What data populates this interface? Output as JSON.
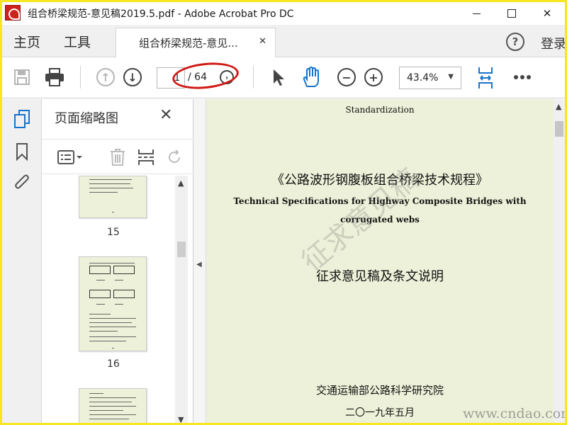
{
  "window": {
    "title": "组合桥梁规范-意见稿2019.5.pdf - Adobe Acrobat Pro DC"
  },
  "menu": {
    "home": "主页",
    "tools": "工具",
    "doc_tab": "组合桥梁规范-意见...",
    "login": "登录"
  },
  "toolbar": {
    "current_page": "1",
    "total_pages": "/ 64",
    "zoom": "43.4%"
  },
  "panel": {
    "title": "页面缩略图",
    "thumbnails": [
      {
        "label": "15"
      },
      {
        "label": "16"
      }
    ]
  },
  "document": {
    "header": "Standardization",
    "title_cn": "《公路波形钢腹板组合桥梁技术规程》",
    "title_en_1": "Technical Specifications for Highway Composite Bridges with",
    "title_en_2": "corrugated webs",
    "subtitle_cn": "征求意见稿及条文说明",
    "org": "交通运输部公路科学研究院",
    "date": "二〇一九年五月",
    "watermark": "征求意见稿"
  },
  "overlay": {
    "site_watermark": "www.cndao.com"
  },
  "colors": {
    "frame_border": "#f5e81e",
    "highlight_ellipse": "#d11a14",
    "page_bg": "#eef1d9"
  }
}
